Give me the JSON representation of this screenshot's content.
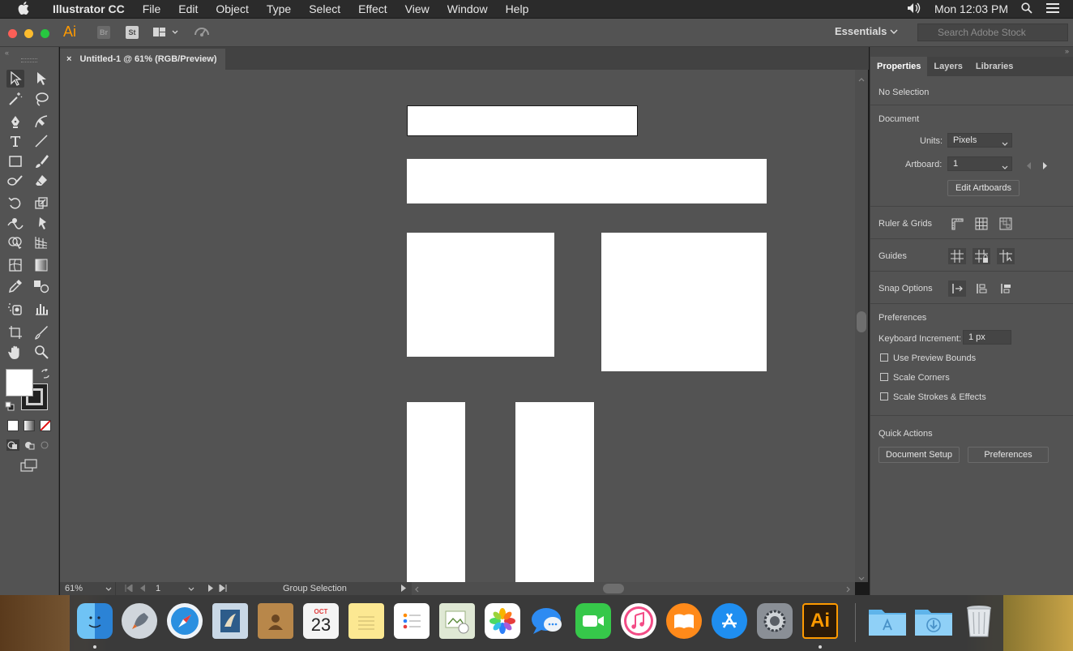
{
  "menubar": {
    "app_name": "Illustrator CC",
    "items": [
      "File",
      "Edit",
      "Object",
      "Type",
      "Select",
      "Effect",
      "View",
      "Window",
      "Help"
    ],
    "clock": "Mon 12:03 PM"
  },
  "appbar": {
    "logo": "Ai",
    "br_label": "Br",
    "st_label": "St",
    "workspace": "Essentials",
    "search_placeholder": "Search Adobe Stock"
  },
  "document": {
    "tab_title": "Untitled-1 @ 61% (RGB/Preview)",
    "close_glyph": "×"
  },
  "statusbar": {
    "zoom": "61%",
    "artboard": "1",
    "tool_name": "Group Selection"
  },
  "panel": {
    "tabs": [
      "Properties",
      "Layers",
      "Libraries"
    ],
    "selection_state": "No Selection",
    "document_title": "Document",
    "units_label": "Units:",
    "units_value": "Pixels",
    "artboard_label": "Artboard:",
    "artboard_value": "1",
    "edit_artboards": "Edit Artboards",
    "rulers_label": "Ruler & Grids",
    "guides_label": "Guides",
    "snap_label": "Snap Options",
    "preferences_title": "Preferences",
    "keyboard_label": "Keyboard Increment:",
    "keyboard_value": "1 px",
    "checkboxes": [
      "Use Preview Bounds",
      "Scale Corners",
      "Scale Strokes & Effects"
    ],
    "quick_actions_title": "Quick Actions",
    "document_setup": "Document Setup",
    "preferences_button": "Preferences"
  },
  "dock": {
    "calendar_month": "OCT",
    "calendar_day": "23",
    "illustrator_label": "Ai"
  },
  "colors": {
    "ui_dark": "#535353",
    "illustrator_orange": "#ff9a00",
    "artboard_fill": "#ffffff"
  }
}
